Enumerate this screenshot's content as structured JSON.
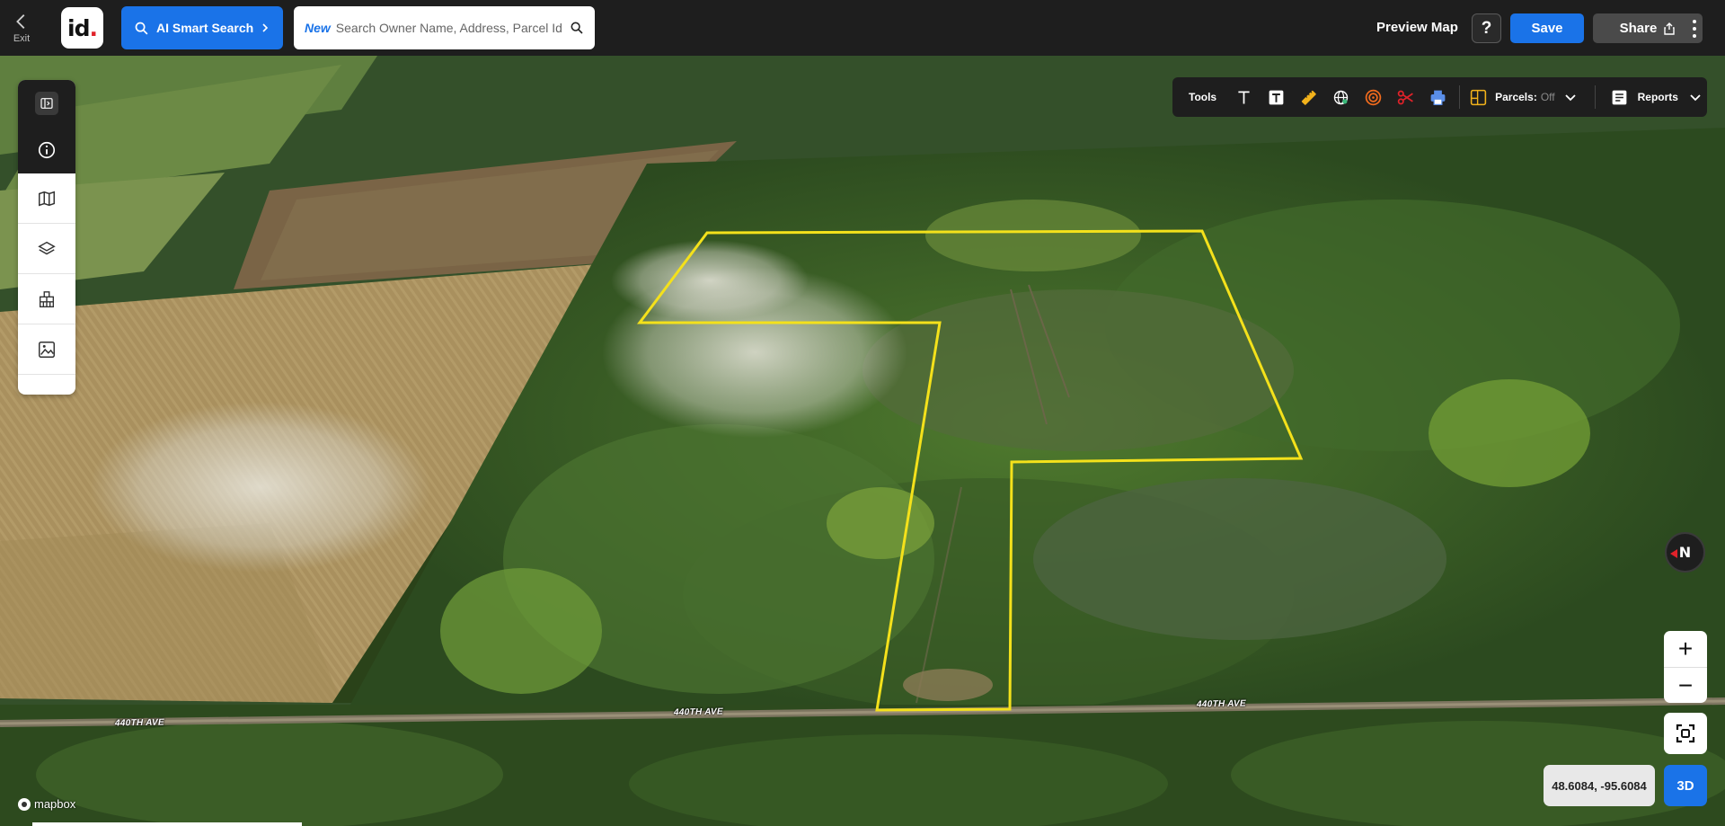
{
  "topbar": {
    "exit_label": "Exit",
    "logo_text": "id",
    "logo_dot": ".",
    "ai_search_label": "AI Smart Search",
    "search_new_tag": "New",
    "search_placeholder": "Search Owner Name, Address, Parcel Id",
    "preview_label": "Preview Map",
    "help_label": "?",
    "save_label": "Save",
    "share_label": "Share"
  },
  "tools": {
    "label": "Tools",
    "icons": [
      "text-icon",
      "text-box-icon",
      "ruler-icon",
      "globe-measure-icon",
      "radius-icon",
      "scissors-icon",
      "print-icon"
    ],
    "parcels_label": "Parcels:",
    "parcels_state": "Off",
    "reports_label": "Reports"
  },
  "sidebar": {
    "items": [
      "panel-toggle-icon",
      "info-icon",
      "map-icon",
      "layers-icon",
      "buildings-icon",
      "image-icon"
    ]
  },
  "map": {
    "road_labels": [
      "440TH AVE",
      "440TH AVE",
      "440TH AVE"
    ],
    "compass_label": "N",
    "zoom_in": "+",
    "zoom_out": "−",
    "coordinates": "48.6084, -95.6084",
    "mode_3d": "3D",
    "attribution": "mapbox",
    "parcel_outline_color": "#f4e11b"
  },
  "colors": {
    "accent": "#1a73e8",
    "topbar_bg": "#1e1e1e",
    "logo_dot": "#e0222a"
  }
}
